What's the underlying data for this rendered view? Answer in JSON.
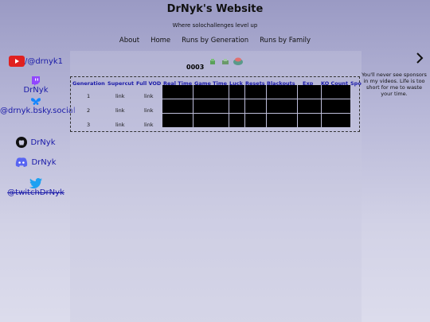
{
  "site": {
    "title": "DrNyk's Website",
    "tagline": "Where solochallenges level up"
  },
  "nav": {
    "items": [
      "About",
      "Home",
      "Runs by Generation",
      "Runs by Family"
    ]
  },
  "sidebar": {
    "youtube": "/@drnyk1",
    "twitch": "DrNyk",
    "bluesky": "@drnyk.bsky.social",
    "github": "DrNyk",
    "discord": "DrNyk",
    "twitter": "@twitchDrNyk"
  },
  "run": {
    "number": "0003"
  },
  "table": {
    "headers": [
      "Generation",
      "Supercut",
      "Full VOD",
      "Real Time",
      "Game Time",
      "Luck",
      "Resets",
      "Blackouts",
      "Exp",
      "KO Count",
      "Spo"
    ],
    "rows": [
      {
        "gen": "1",
        "supercut": "link",
        "vod": "link"
      },
      {
        "gen": "2",
        "supercut": "link",
        "vod": "link"
      },
      {
        "gen": "3",
        "supercut": "link",
        "vod": "link"
      }
    ]
  },
  "right_panel": {
    "sponsor_text": "You'll never see sponsors in my videos. Life is too short for me to waste your time."
  },
  "colors": {
    "link_blue": "#1a1aa8",
    "youtube_red": "#e02020",
    "twitch_purple": "#9146ff",
    "bluesky_blue": "#1185fe",
    "discord_blurple": "#5865f2",
    "twitter_blue": "#1da1f2"
  }
}
